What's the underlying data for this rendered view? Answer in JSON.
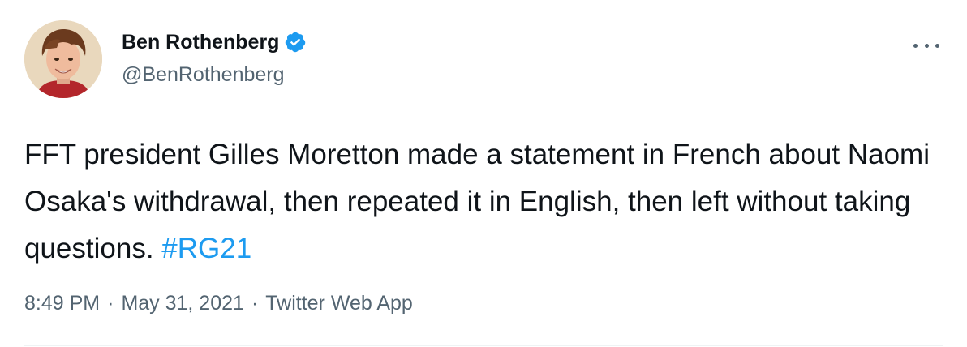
{
  "author": {
    "display_name": "Ben Rothenberg",
    "handle": "@BenRothenberg",
    "verified": true,
    "verified_icon": "verified-badge-icon"
  },
  "tweet": {
    "text_before": "FFT president Gilles Moretton made a statement in French about Naomi Osaka's withdrawal, then repeated it in English, then left without taking questions.",
    "hashtag": "#RG21"
  },
  "meta": {
    "time": "8:49 PM",
    "separator_1": "·",
    "date": "May 31, 2021",
    "separator_2": "·",
    "source": "Twitter Web App"
  },
  "menu": {
    "icon": "more-options-icon"
  },
  "colors": {
    "text": "#0f1419",
    "secondary": "#536471",
    "accent": "#1d9bf0",
    "divider": "#eff3f4"
  }
}
